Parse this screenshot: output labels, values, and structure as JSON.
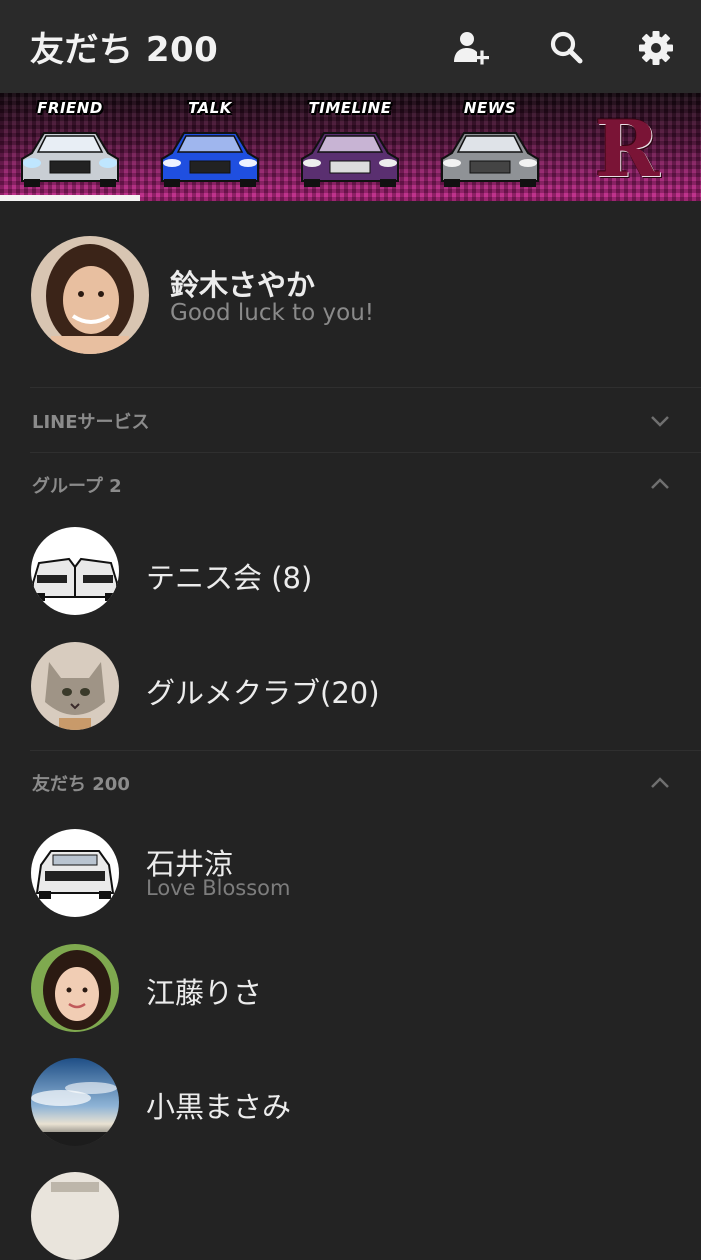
{
  "header": {
    "title": "友だち 200",
    "icons": [
      "add-friend-icon",
      "search-icon",
      "settings-icon"
    ]
  },
  "tabs": [
    {
      "label": "FRIEND",
      "car_color": "#c9ced4",
      "active": true
    },
    {
      "label": "TALK",
      "car_color": "#1f4fe0",
      "active": false
    },
    {
      "label": "TIMELINE",
      "car_color": "#5a2f70",
      "active": false
    },
    {
      "label": "NEWS",
      "car_color": "#8f9296",
      "active": false
    }
  ],
  "tab_logo": "R",
  "profile": {
    "name": "鈴木さやか",
    "status": "Good luck to you!"
  },
  "sections": {
    "line_services": {
      "label": "LINEサービス",
      "expanded": false
    },
    "groups": {
      "label": "グループ 2",
      "expanded": true
    },
    "friends": {
      "label": "友だち 200",
      "expanded": true
    }
  },
  "groups": [
    {
      "name": "テニス会 (8)"
    },
    {
      "name": "グルメクラブ(20)"
    }
  ],
  "friends": [
    {
      "name": "石井涼",
      "status": "Love Blossom"
    },
    {
      "name": "江藤りさ",
      "status": ""
    },
    {
      "name": "小黒まさみ",
      "status": ""
    }
  ],
  "colors": {
    "background": "#232323",
    "header": "#2a2a2a",
    "tab_banner": "#a01f73",
    "text_primary": "#ececec",
    "text_secondary": "#8a8a8a"
  }
}
